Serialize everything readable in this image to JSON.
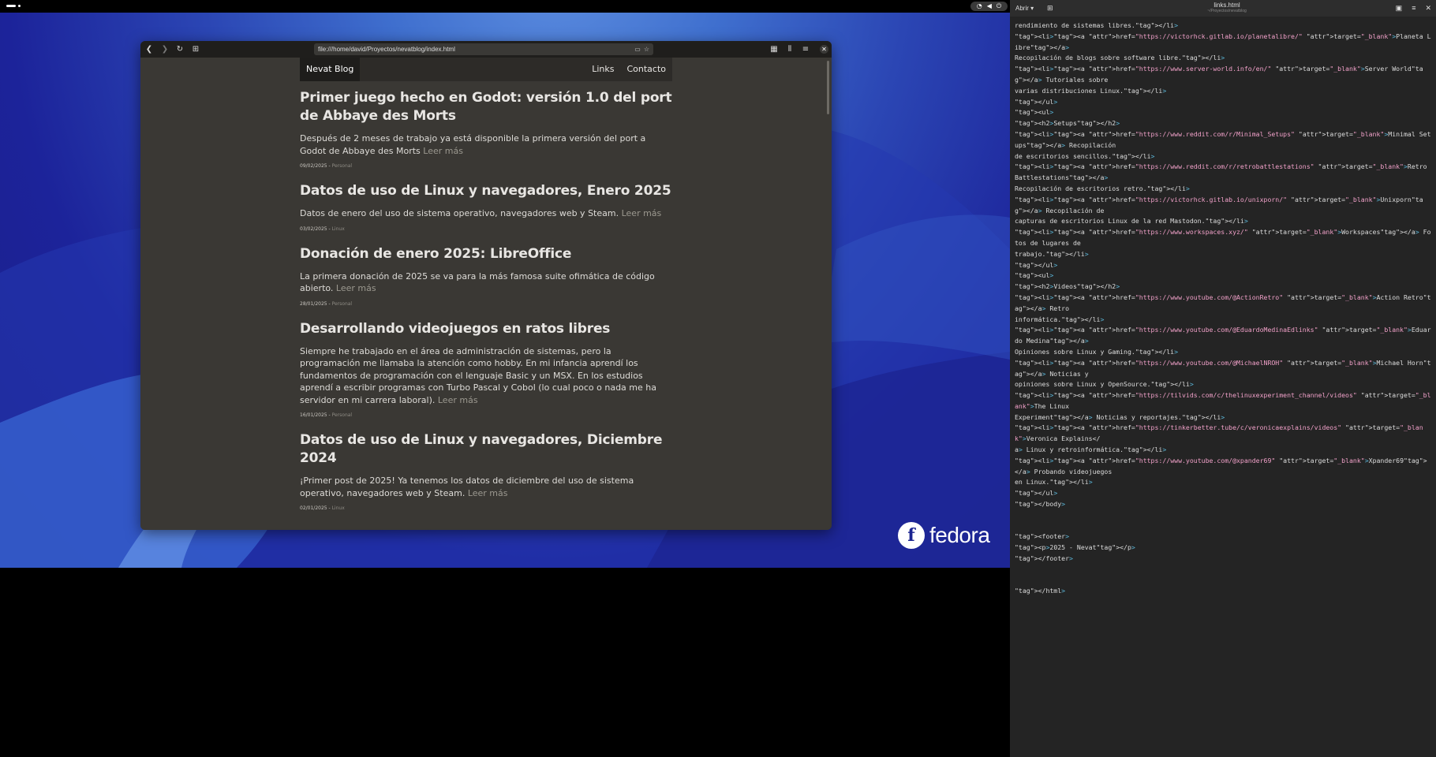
{
  "system": {
    "status_icons": [
      "wifi-icon",
      "volume-icon",
      "power-icon"
    ]
  },
  "desktop": {
    "logo_text": "fedora"
  },
  "browser": {
    "url": "file:///home/david/Proyectos/nevatblog/index.html",
    "site_brand": "Nevat Blog",
    "nav_links": [
      "Links",
      "Contacto"
    ],
    "posts": [
      {
        "title": "Primer juego hecho en Godot: versión 1.0 del port de Abbaye des Morts",
        "excerpt": "Después de 2 meses de trabajo ya está disponible la primera versión del port a Godot de Abbaye des Morts",
        "more": "Leer más",
        "date": "09/02/2025",
        "category": "Personal"
      },
      {
        "title": "Datos de uso de Linux y navegadores, Enero 2025",
        "excerpt": "Datos de enero del uso de sistema operativo, navegadores web y Steam.",
        "more": "Leer más",
        "date": "03/02/2025",
        "category": "Linux"
      },
      {
        "title": "Donación de enero 2025: LibreOffice",
        "excerpt": "La primera donación de 2025 se va para la más famosa suite ofimática de código abierto.",
        "more": "Leer más",
        "date": "28/01/2025",
        "category": "Personal"
      },
      {
        "title": "Desarrollando videojuegos en ratos libres",
        "excerpt": "Siempre he trabajado en el área de administración de sistemas, pero la programación me llamaba la atención como hobby. En mi infancia aprendí los fundamentos de programación con el lenguaje Basic y un MSX. En los estudios aprendí a escribir programas con Turbo Pascal y Cobol (lo cual poco o nada me ha servidor en mi carrera laboral).",
        "more": "Leer más",
        "date": "16/01/2025",
        "category": "Personal"
      },
      {
        "title": "Datos de uso de Linux y navegadores, Diciembre 2024",
        "excerpt": "¡Primer post de 2025! Ya tenemos los datos de diciembre del uso de sistema operativo, navegadores web y Steam.",
        "more": "Leer más",
        "date": "02/01/2025",
        "category": "Linux"
      }
    ]
  },
  "editor": {
    "open_label": "Abrir",
    "file_name": "links.html",
    "file_path": "~/Proyectos/nevatblog",
    "code_lines": [
      "rendimiento de sistemas libres.</li>",
      "<li><a href=\"https://victorhck.gitlab.io/planetalibre/\" target=\"_blank\">Planeta Libre</a>",
      "Recopilación de blogs sobre software libre.</li>",
      "<li><a href=\"https://www.server-world.info/en/\" target=\"_blank\">Server World</a> Tutoriales sobre",
      "varias distribuciones Linux.</li>",
      "</ul>",
      "<ul>",
      "<h2>Setups</h2>",
      "<li><a href=\"https://www.reddit.com/r/Minimal_Setups\" target=\"_blank\">Minimal Setups</a> Recopilación",
      "de escritorios sencillos.</li>",
      "<li><a href=\"https://www.reddit.com/r/retrobattlestations\" target=\"_blank\">Retro Battlestations</a>",
      "Recopilación de escritorios retro.</li>",
      "<li><a href=\"https://victorhck.gitlab.io/unixporn/\" target=\"_blank\">Unixporn</a> Recopilación de",
      "capturas de escritorios Linux de la red Mastodon.</li>",
      "<li><a href=\"https://www.workspaces.xyz/\" target=\"_blank\">Workspaces</a> Fotos de lugares de",
      "trabajo.</li>",
      "</ul>",
      "<ul>",
      "<h2>Videos</h2>",
      "<li><a href=\"https://www.youtube.com/@ActionRetro\" target=\"_blank\">Action Retro</a> Retro",
      "informática.</li>",
      "<li><a href=\"https://www.youtube.com/@EduardoMedinaEdlinks\" target=\"_blank\">Eduardo Medina</a>",
      "Opiniones sobre Linux y Gaming.</li>",
      "<li><a href=\"https://www.youtube.com/@MichaelNROH\" target=\"_blank\">Michael Horn</a> Noticias y",
      "opiniones sobre Linux y OpenSource.</li>",
      "<li><a href=\"https://tilvids.com/c/thelinuxexperiment_channel/videos\" target=\"_blank\">The Linux",
      "Experiment</a> Noticias y reportajes.</li>",
      "<li><a href=\"https://tinkerbetter.tube/c/veronicaexplains/videos\" target=\"_blank\">Veronica Explains</",
      "a> Linux y retroinformática.</li>",
      "<li><a href=\"https://www.youtube.com/@xpander69\" target=\"_blank\">Xpander69</a> Probando videojuegos",
      "en Linux.</li>",
      "</ul>",
      "</body>",
      "",
      "",
      "<footer>",
      "<p>2025 - Nevat</p>",
      "</footer>",
      "",
      "",
      "</html>"
    ]
  }
}
